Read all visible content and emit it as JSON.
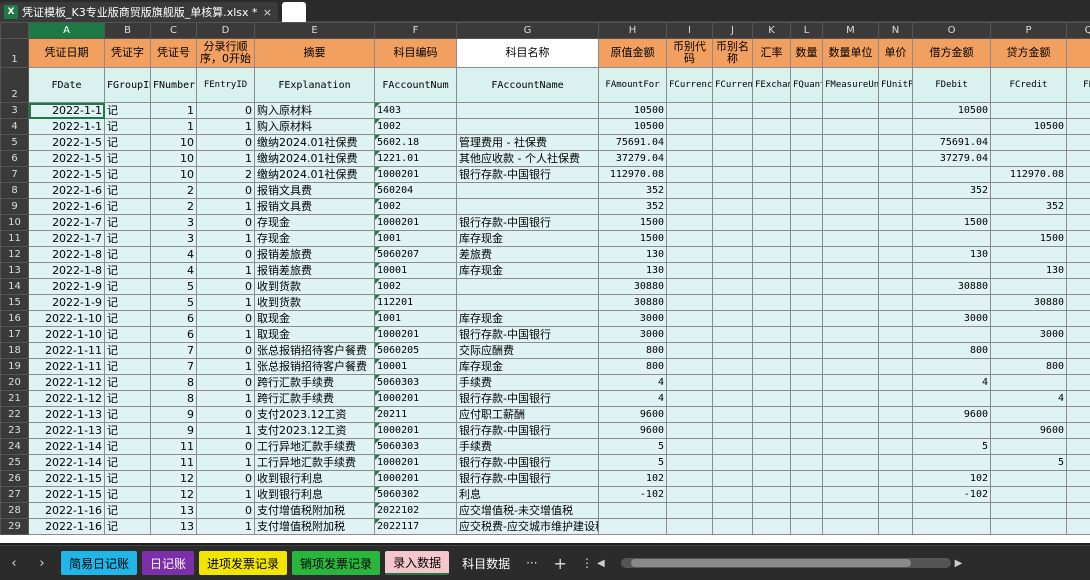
{
  "window": {
    "file_title": "凭证模板_K3专业版商贸版旗舰版_单核算.xlsx *",
    "close": "×",
    "excel_icon": "X"
  },
  "columns": [
    "A",
    "B",
    "C",
    "D",
    "E",
    "F",
    "G",
    "H",
    "I",
    "J",
    "K",
    "L",
    "M",
    "N",
    "O",
    "P",
    "Q"
  ],
  "header_cn": [
    "凭证日期",
    "凭证字",
    "凭证号",
    "分录行顺序，0开始",
    "摘要",
    "科目编码",
    "科目名称",
    "原值金额",
    "币别代码",
    "币别名称",
    "汇率",
    "数量",
    "数量单位",
    "单价",
    "借方金额",
    "贷方金额",
    ""
  ],
  "header_en": [
    "FDate",
    "FGroupID",
    "FNumber",
    "FEntryID",
    "FExplanation",
    "FAccountNum",
    "FAccountName",
    "FAmountFor",
    "FCurrencyNum",
    "FCurrencyName",
    "FExchangeRate",
    "FQuantity",
    "FMeasureUnitID",
    "FUnitPrice",
    "FDebit",
    "FCredit",
    "FP"
  ],
  "rows": [
    {
      "n": "3",
      "date": "2022-1-1",
      "g": "记",
      "num": "1",
      "e": "0",
      "exp": "购入原材料",
      "acct": "1403",
      "name": "",
      "amt": "10500",
      "debit": "10500",
      "credit": ""
    },
    {
      "n": "4",
      "date": "2022-1-1",
      "g": "记",
      "num": "1",
      "e": "1",
      "exp": "购入原材料",
      "acct": "1002",
      "name": "",
      "amt": "10500",
      "debit": "",
      "credit": "10500"
    },
    {
      "n": "5",
      "date": "2022-1-5",
      "g": "记",
      "num": "10",
      "e": "0",
      "exp": "缴纳2024.01社保费",
      "acct": "5602.18",
      "name": "管理费用 - 社保费",
      "amt": "75691.04",
      "debit": "75691.04",
      "credit": ""
    },
    {
      "n": "6",
      "date": "2022-1-5",
      "g": "记",
      "num": "10",
      "e": "1",
      "exp": "缴纳2024.01社保费",
      "acct": "1221.01",
      "name": "其他应收款 - 个人社保费",
      "amt": "37279.04",
      "debit": "37279.04",
      "credit": ""
    },
    {
      "n": "7",
      "date": "2022-1-5",
      "g": "记",
      "num": "10",
      "e": "2",
      "exp": "缴纳2024.01社保费",
      "acct": "1000201",
      "name": "银行存款-中国银行",
      "amt": "112970.08",
      "debit": "",
      "credit": "112970.08"
    },
    {
      "n": "8",
      "date": "2022-1-6",
      "g": "记",
      "num": "2",
      "e": "0",
      "exp": "报销文具费",
      "acct": "560204",
      "name": "",
      "amt": "352",
      "debit": "352",
      "credit": ""
    },
    {
      "n": "9",
      "date": "2022-1-6",
      "g": "记",
      "num": "2",
      "e": "1",
      "exp": "报销文具费",
      "acct": "1002",
      "name": "",
      "amt": "352",
      "debit": "",
      "credit": "352"
    },
    {
      "n": "10",
      "date": "2022-1-7",
      "g": "记",
      "num": "3",
      "e": "0",
      "exp": "存现金",
      "acct": "1000201",
      "name": "银行存款-中国银行",
      "amt": "1500",
      "debit": "1500",
      "credit": ""
    },
    {
      "n": "11",
      "date": "2022-1-7",
      "g": "记",
      "num": "3",
      "e": "1",
      "exp": "存现金",
      "acct": "1001",
      "name": "库存现金",
      "amt": "1500",
      "debit": "",
      "credit": "1500"
    },
    {
      "n": "12",
      "date": "2022-1-8",
      "g": "记",
      "num": "4",
      "e": "0",
      "exp": "报销差旅费",
      "acct": "5060207",
      "name": "差旅费",
      "amt": "130",
      "debit": "130",
      "credit": ""
    },
    {
      "n": "13",
      "date": "2022-1-8",
      "g": "记",
      "num": "4",
      "e": "1",
      "exp": "报销差旅费",
      "acct": "10001",
      "name": "库存现金",
      "amt": "130",
      "debit": "",
      "credit": "130"
    },
    {
      "n": "14",
      "date": "2022-1-9",
      "g": "记",
      "num": "5",
      "e": "0",
      "exp": "收到货款",
      "acct": "1002",
      "name": "",
      "amt": "30880",
      "debit": "30880",
      "credit": ""
    },
    {
      "n": "15",
      "date": "2022-1-9",
      "g": "记",
      "num": "5",
      "e": "1",
      "exp": "收到货款",
      "acct": "112201",
      "name": "",
      "amt": "30880",
      "debit": "",
      "credit": "30880"
    },
    {
      "n": "16",
      "date": "2022-1-10",
      "g": "记",
      "num": "6",
      "e": "0",
      "exp": "取现金",
      "acct": "1001",
      "name": "库存现金",
      "amt": "3000",
      "debit": "3000",
      "credit": ""
    },
    {
      "n": "17",
      "date": "2022-1-10",
      "g": "记",
      "num": "6",
      "e": "1",
      "exp": "取现金",
      "acct": "1000201",
      "name": "银行存款-中国银行",
      "amt": "3000",
      "debit": "",
      "credit": "3000"
    },
    {
      "n": "18",
      "date": "2022-1-11",
      "g": "记",
      "num": "7",
      "e": "0",
      "exp": "张总报销招待客户餐费",
      "acct": "5060205",
      "name": "交际应酬费",
      "amt": "800",
      "debit": "800",
      "credit": ""
    },
    {
      "n": "19",
      "date": "2022-1-11",
      "g": "记",
      "num": "7",
      "e": "1",
      "exp": "张总报销招待客户餐费",
      "acct": "10001",
      "name": "库存现金",
      "amt": "800",
      "debit": "",
      "credit": "800"
    },
    {
      "n": "20",
      "date": "2022-1-12",
      "g": "记",
      "num": "8",
      "e": "0",
      "exp": "跨行汇款手续费",
      "acct": "5060303",
      "name": "手续费",
      "amt": "4",
      "debit": "4",
      "credit": ""
    },
    {
      "n": "21",
      "date": "2022-1-12",
      "g": "记",
      "num": "8",
      "e": "1",
      "exp": "跨行汇款手续费",
      "acct": "1000201",
      "name": "银行存款-中国银行",
      "amt": "4",
      "debit": "",
      "credit": "4"
    },
    {
      "n": "22",
      "date": "2022-1-13",
      "g": "记",
      "num": "9",
      "e": "0",
      "exp": "支付2023.12工资",
      "acct": "20211",
      "name": "应付职工薪酬",
      "amt": "9600",
      "debit": "9600",
      "credit": ""
    },
    {
      "n": "23",
      "date": "2022-1-13",
      "g": "记",
      "num": "9",
      "e": "1",
      "exp": "支付2023.12工资",
      "acct": "1000201",
      "name": "银行存款-中国银行",
      "amt": "9600",
      "debit": "",
      "credit": "9600"
    },
    {
      "n": "24",
      "date": "2022-1-14",
      "g": "记",
      "num": "11",
      "e": "0",
      "exp": "工行异地汇款手续费",
      "acct": "5060303",
      "name": "手续费",
      "amt": "5",
      "debit": "5",
      "credit": ""
    },
    {
      "n": "25",
      "date": "2022-1-14",
      "g": "记",
      "num": "11",
      "e": "1",
      "exp": "工行异地汇款手续费",
      "acct": "1000201",
      "name": "银行存款-中国银行",
      "amt": "5",
      "debit": "",
      "credit": "5"
    },
    {
      "n": "26",
      "date": "2022-1-15",
      "g": "记",
      "num": "12",
      "e": "0",
      "exp": "收到银行利息",
      "acct": "1000201",
      "name": "银行存款-中国银行",
      "amt": "102",
      "debit": "102",
      "credit": ""
    },
    {
      "n": "27",
      "date": "2022-1-15",
      "g": "记",
      "num": "12",
      "e": "1",
      "exp": "收到银行利息",
      "acct": "5060302",
      "name": "利息",
      "amt": "-102",
      "debit": "-102",
      "credit": ""
    },
    {
      "n": "28",
      "date": "2022-1-16",
      "g": "记",
      "num": "13",
      "e": "0",
      "exp": "支付增值税附加税",
      "acct": "2022102",
      "name": "应交增值税-未交增值税",
      "amt": "",
      "debit": "",
      "credit": ""
    },
    {
      "n": "29",
      "date": "2022-1-16",
      "g": "记",
      "num": "13",
      "e": "1",
      "exp": "支付增值税附加税",
      "acct": "2022117",
      "name": "应交税费-应交城市维护建设税",
      "amt": "",
      "debit": "",
      "credit": ""
    }
  ],
  "sheet_nav": {
    "prev": "‹",
    "next": "›",
    "more": "···",
    "add": "+",
    "menu": "⋮",
    "scroll_left": "◀",
    "scroll_right": "▶"
  },
  "sheets": [
    {
      "label": "简易日记账",
      "bg": "#21b5e8",
      "fg": "#000"
    },
    {
      "label": "日记账",
      "bg": "#7b2fa8",
      "fg": "#fff"
    },
    {
      "label": "进项发票记录",
      "bg": "#f2e600",
      "fg": "#000"
    },
    {
      "label": "销项发票记录",
      "bg": "#28b63c",
      "fg": "#000"
    },
    {
      "label": "录入数据",
      "bg": "#f3c7cd",
      "fg": "#000",
      "active": true
    },
    {
      "label": "科目数据",
      "bg": "#2b2b2b",
      "fg": "#fff"
    }
  ]
}
